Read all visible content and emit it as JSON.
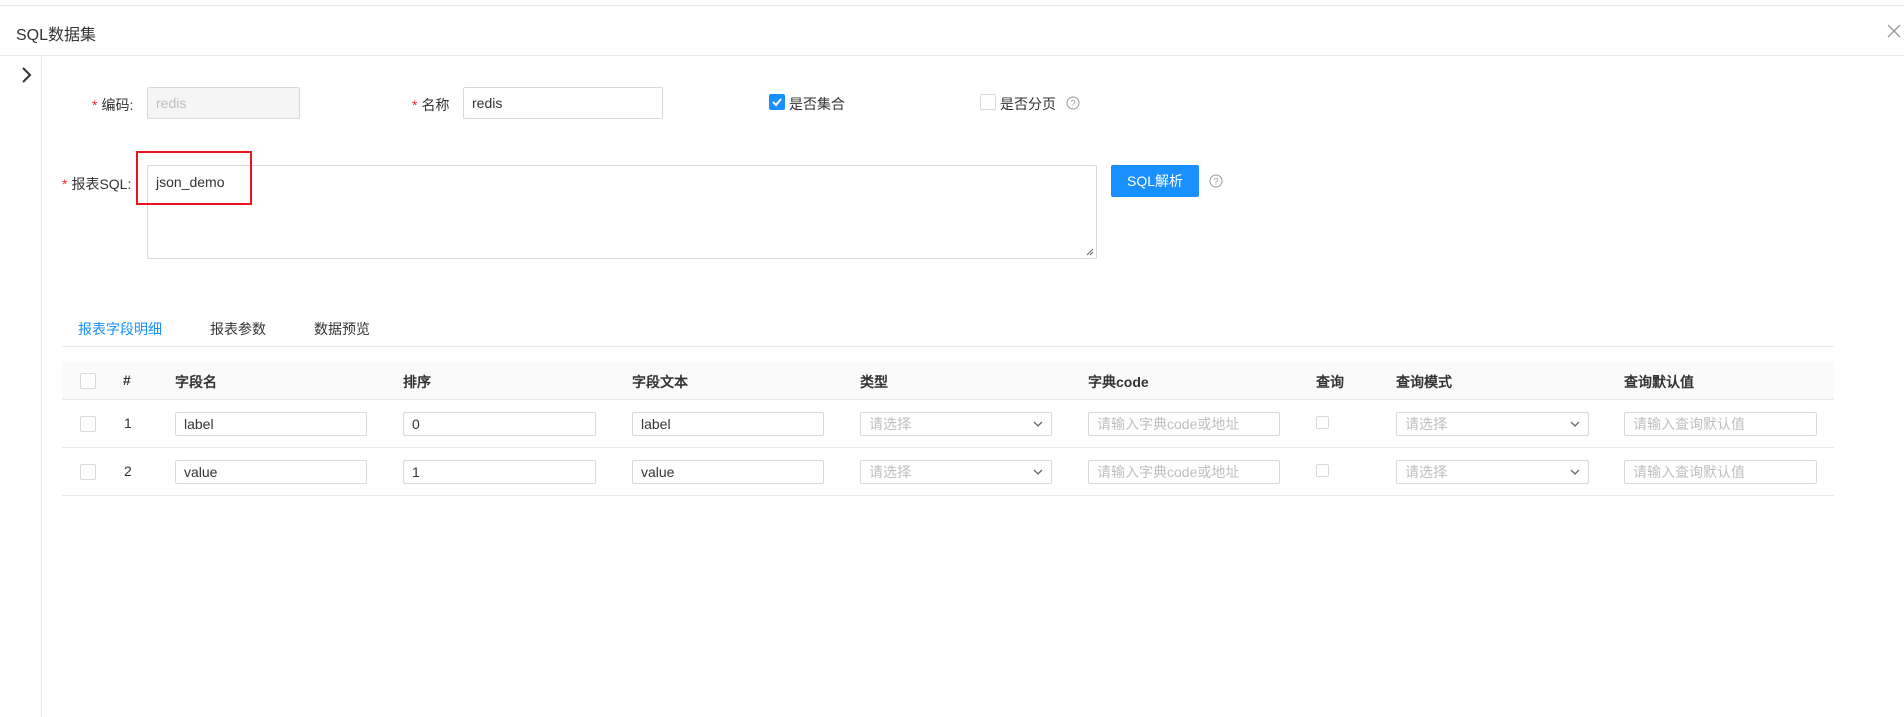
{
  "modal": {
    "title": "SQL数据集"
  },
  "form": {
    "code_label": "编码:",
    "code_value": "redis",
    "name_label": "名称",
    "name_value": "redis",
    "is_collection_label": "是否集合",
    "is_collection_checked": true,
    "is_paged_label": "是否分页",
    "is_paged_checked": false,
    "sql_label": "报表SQL:",
    "sql_value": "json_demo",
    "parse_button": "SQL解析",
    "required_mark": "*"
  },
  "tabs": [
    {
      "label": "报表字段明细",
      "active": true
    },
    {
      "label": "报表参数",
      "active": false
    },
    {
      "label": "数据预览",
      "active": false
    }
  ],
  "table": {
    "columns": [
      "#",
      "字段名",
      "排序",
      "字段文本",
      "类型",
      "字典code",
      "查询",
      "查询模式",
      "查询默认值"
    ],
    "rows": [
      {
        "index": "1",
        "field_name": "label",
        "order": "0",
        "field_text": "label",
        "type_placeholder": "请选择",
        "dict_placeholder": "请输入字典code或地址",
        "query_mode_placeholder": "请选择",
        "default_placeholder": "请输入查询默认值"
      },
      {
        "index": "2",
        "field_name": "value",
        "order": "1",
        "field_text": "value",
        "type_placeholder": "请选择",
        "dict_placeholder": "请输入字典code或地址",
        "query_mode_placeholder": "请选择",
        "default_placeholder": "请输入查询默认值"
      }
    ]
  },
  "colors": {
    "primary": "#1890ff",
    "required": "#f5222d",
    "highlight": "#e8131c"
  }
}
